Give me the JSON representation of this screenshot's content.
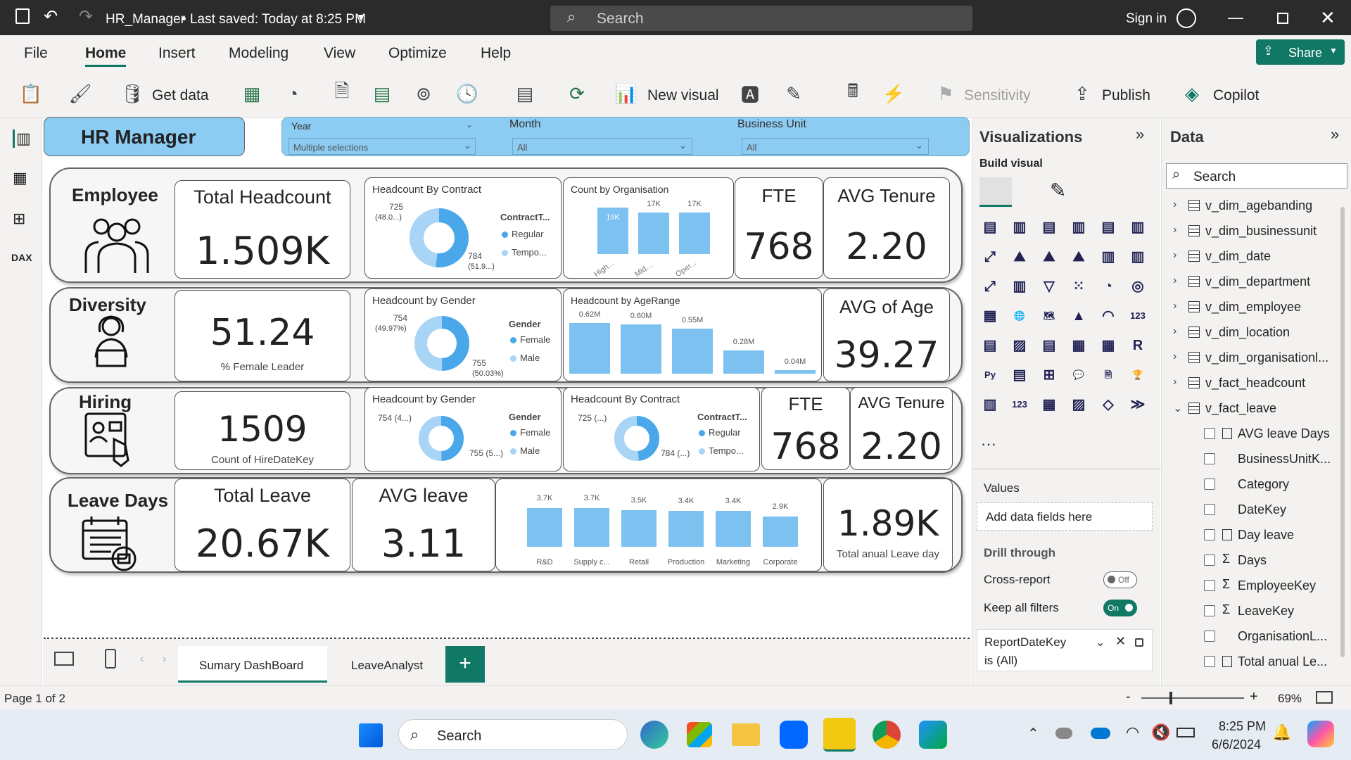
{
  "titlebar": {
    "file_title": "HR_Manager",
    "saved": "• Last saved: Today at 8:25 PM",
    "search": "Search",
    "signin": "Sign in"
  },
  "menu": {
    "items": [
      "File",
      "Home",
      "Insert",
      "Modeling",
      "View",
      "Optimize",
      "Help"
    ],
    "share": "Share"
  },
  "ribbon": {
    "get_data": "Get data",
    "new_visual": "New visual",
    "sensitivity": "Sensitivity",
    "publish": "Publish",
    "copilot": "Copilot"
  },
  "header": {
    "title": "HR Manager",
    "filters": [
      {
        "label": "Year",
        "value": "Multiple selections"
      },
      {
        "label": "Month",
        "value": "All"
      },
      {
        "label": "Business Unit",
        "value": "All"
      }
    ]
  },
  "rows": {
    "employee": {
      "label": "Employee",
      "kpi_title": "Total Headcount",
      "kpi_value": "1.509K",
      "fte_title": "FTE",
      "fte_value": "768",
      "tenure_title": "AVG Tenure",
      "tenure_value": "2.20",
      "donut": {
        "title": "Headcount By Contract",
        "a_val": "725",
        "a_pct": "(48.0...)",
        "b_val": "784",
        "b_pct": "(51.9...)",
        "legend_title": "ContractT...",
        "leg1": "Regular",
        "leg2": "Tempo..."
      },
      "org": {
        "title": "Count by Organisation",
        "labels": [
          "19K",
          "17K",
          "17K"
        ],
        "cats": [
          "High...",
          "Mid...",
          "Oper..."
        ]
      }
    },
    "diversity": {
      "label": "Diversity",
      "kpi_value": "51.24",
      "kpi_caption": "% Female Leader",
      "age_title": "AVG of Age",
      "age_value": "39.27",
      "donut": {
        "title": "Headcount by Gender",
        "a_val": "754",
        "a_pct": "(49.97%)",
        "b_val": "755",
        "b_pct": "(50.03%)",
        "legend_title": "Gender",
        "leg1": "Female",
        "leg2": "Male"
      },
      "age": {
        "title": "Headcount by AgeRange",
        "labels": [
          "0.62M",
          "0.60M",
          "0.55M",
          "0.28M",
          "0.04M"
        ]
      }
    },
    "hiring": {
      "label": "Hiring",
      "kpi_value": "1509",
      "kpi_caption": "Count of HireDateKey",
      "fte_title": "FTE",
      "fte_value": "768",
      "tenure_title": "AVG Tenure",
      "tenure_value": "2.20",
      "gender": {
        "title": "Headcount by Gender",
        "a": "754 (4...)",
        "b": "755 (5...)",
        "legend_title": "Gender",
        "leg1": "Female",
        "leg2": "Male"
      },
      "contract": {
        "title": "Headcount By Contract",
        "a": "725 (...)",
        "b": "784 (...)",
        "legend_title": "ContractT...",
        "leg1": "Regular",
        "leg2": "Tempo..."
      }
    },
    "leave": {
      "label": "Leave Days",
      "total_title": "Total Leave",
      "total_value": "20.67K",
      "avg_title": "AVG leave",
      "avg_value": "3.11",
      "anual_value": "1.89K",
      "anual_caption": "Total anual Leave day",
      "bars": {
        "labels": [
          "3.7K",
          "3.7K",
          "3.5K",
          "3.4K",
          "3.4K",
          "2.9K"
        ],
        "cats": [
          "R&D",
          "Supply c...",
          "Retail",
          "Production",
          "Marketing",
          "Corporate"
        ]
      }
    }
  },
  "chart_data": [
    {
      "type": "bar",
      "title": "Count by Organisation",
      "categories": [
        "High...",
        "Mid...",
        "Oper..."
      ],
      "values": [
        19000,
        17000,
        17000
      ]
    },
    {
      "type": "bar",
      "title": "Headcount by AgeRange",
      "categories": [
        "",
        "",
        "",
        "",
        ""
      ],
      "values": [
        620000,
        600000,
        550000,
        280000,
        40000
      ]
    },
    {
      "type": "bar",
      "title": "",
      "categories": [
        "R&D",
        "Supply c...",
        "Retail",
        "Production",
        "Marketing",
        "Corporate"
      ],
      "values": [
        3700,
        3700,
        3500,
        3400,
        3400,
        2900
      ]
    },
    {
      "type": "pie",
      "title": "Headcount By Contract",
      "categories": [
        "Regular",
        "Tempo..."
      ],
      "values": [
        725,
        784
      ]
    },
    {
      "type": "pie",
      "title": "Headcount by Gender",
      "categories": [
        "Female",
        "Male"
      ],
      "values": [
        754,
        755
      ]
    }
  ],
  "tabs": {
    "t1": "Sumary DashBoard",
    "t2": "LeaveAnalyst",
    "add": "+"
  },
  "status": {
    "page": "Page 1 of 2",
    "zoom": "69%"
  },
  "vis": {
    "title": "Visualizations",
    "build": "Build visual",
    "values": "Values",
    "add_fields": "Add data fields here",
    "drill": "Drill through",
    "cross": "Cross-report",
    "cross_state": "Off",
    "keep": "Keep all filters",
    "keep_state": "On",
    "filter_name": "ReportDateKey",
    "filter_val": "is (All)"
  },
  "data": {
    "title": "Data",
    "search": "Search",
    "tables": [
      "v_dim_agebanding",
      "v_dim_businessunit",
      "v_dim_date",
      "v_dim_department",
      "v_dim_employee",
      "v_dim_location",
      "v_dim_organisationl...",
      "v_fact_headcount",
      "v_fact_leave"
    ],
    "fields": [
      "AVG leave Days",
      "BusinessUnitK...",
      "Category",
      "DateKey",
      "Day leave",
      "Days",
      "EmployeeKey",
      "LeaveKey",
      "OrganisationL...",
      "Total anual Le..."
    ]
  },
  "taskbar": {
    "search": "Search",
    "time": "8:25 PM",
    "date": "6/6/2024"
  }
}
